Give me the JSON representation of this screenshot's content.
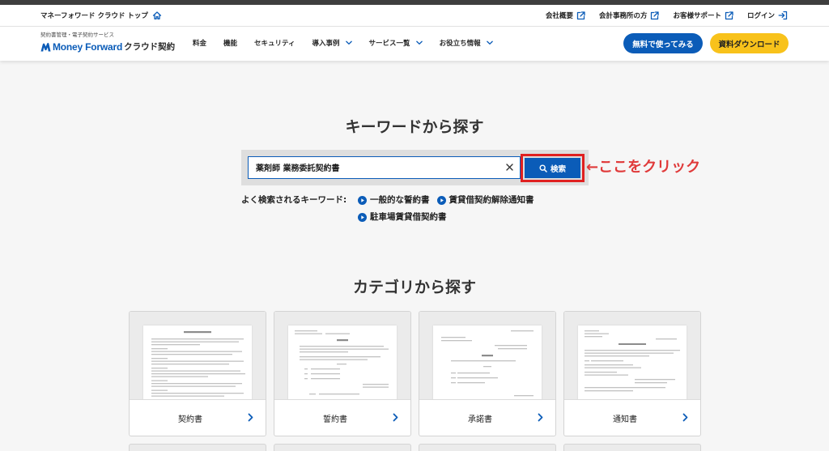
{
  "topbar": {
    "home_link": "マネーフォワード クラウド トップ",
    "home_icon": "home-icon",
    "links": [
      {
        "label": "会社概要",
        "icon": "external-link-icon"
      },
      {
        "label": "会計事務所の方",
        "icon": "external-link-icon"
      },
      {
        "label": "お客様サポート",
        "icon": "external-link-icon"
      },
      {
        "label": "ログイン",
        "icon": "login-icon"
      }
    ]
  },
  "header": {
    "logo_tagline": "契約書管理・電子契約サービス",
    "logo_brand": "Money Forward",
    "logo_product": "クラウド契約",
    "nav": [
      {
        "label": "料金",
        "dropdown": false
      },
      {
        "label": "機能",
        "dropdown": false
      },
      {
        "label": "セキュリティ",
        "dropdown": false
      },
      {
        "label": "導入事例",
        "dropdown": true
      },
      {
        "label": "サービス一覧",
        "dropdown": true
      },
      {
        "label": "お役立ち情報",
        "dropdown": true
      }
    ],
    "cta_primary": "無料で使ってみる",
    "cta_secondary": "資料ダウンロード"
  },
  "search": {
    "heading": "キーワードから探す",
    "query": "薬剤師 業務委託契約書",
    "button_label": "検索",
    "annotation": "←ここをクリック",
    "popular_label": "よく検索されるキーワード:",
    "popular": [
      "一般的な誓約書",
      "賃貸借契約解除通知書",
      "駐車場賃貸借契約書"
    ]
  },
  "categories": {
    "heading": "カテゴリから探す",
    "items": [
      "契約書",
      "誓約書",
      "承諾書",
      "通知書"
    ]
  },
  "colors": {
    "brand_blue": "#0b5cb8",
    "cta_yellow": "#f8c21b",
    "annotation_red": "#e03a3a",
    "highlight_red": "#e02020"
  }
}
